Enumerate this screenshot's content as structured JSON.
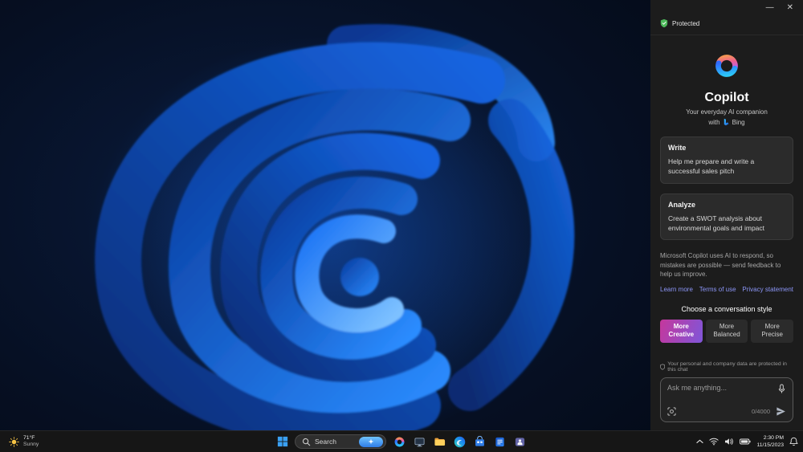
{
  "colors": {
    "link": "#8b95f6",
    "protected-green": "#4db85a",
    "creative-a": "#c5379c",
    "creative-b": "#7f56d9"
  },
  "copilot": {
    "window": {
      "minimize_glyph": "—",
      "close_glyph": "✕"
    },
    "protected_label": "Protected",
    "title": "Copilot",
    "subtitle": "Your everyday AI companion",
    "with_label": "with",
    "bing_label": "Bing",
    "cards": [
      {
        "title": "Write",
        "body": "Help me prepare and write a successful sales pitch"
      },
      {
        "title": "Analyze",
        "body": "Create a SWOT analysis about environmental goals and impact"
      }
    ],
    "disclaimer": "Microsoft Copilot uses AI to respond, so mistakes are possible — send feedback to help us improve.",
    "links": [
      {
        "label": "Learn more"
      },
      {
        "label": "Terms of use"
      },
      {
        "label": "Privacy statement"
      }
    ],
    "style_chooser": {
      "heading": "Choose a conversation style",
      "options": [
        {
          "line1": "More",
          "line2": "Creative",
          "selected": true
        },
        {
          "line1": "More",
          "line2": "Balanced",
          "selected": false
        },
        {
          "line1": "More",
          "line2": "Precise",
          "selected": false
        }
      ]
    },
    "privacy_note": "Your personal and company data are protected in this chat",
    "composer": {
      "placeholder": "Ask me anything...",
      "counter": "0/4000"
    }
  },
  "taskbar": {
    "weather": {
      "temperature": "71°F",
      "condition": "Sunny"
    },
    "search_label": "Search",
    "apps": [
      "copilot",
      "windows-app",
      "file-explorer",
      "edge",
      "microsoft-store",
      "word",
      "teams"
    ],
    "tray": {
      "time": "2:30 PM",
      "date": "11/15/2023"
    }
  }
}
